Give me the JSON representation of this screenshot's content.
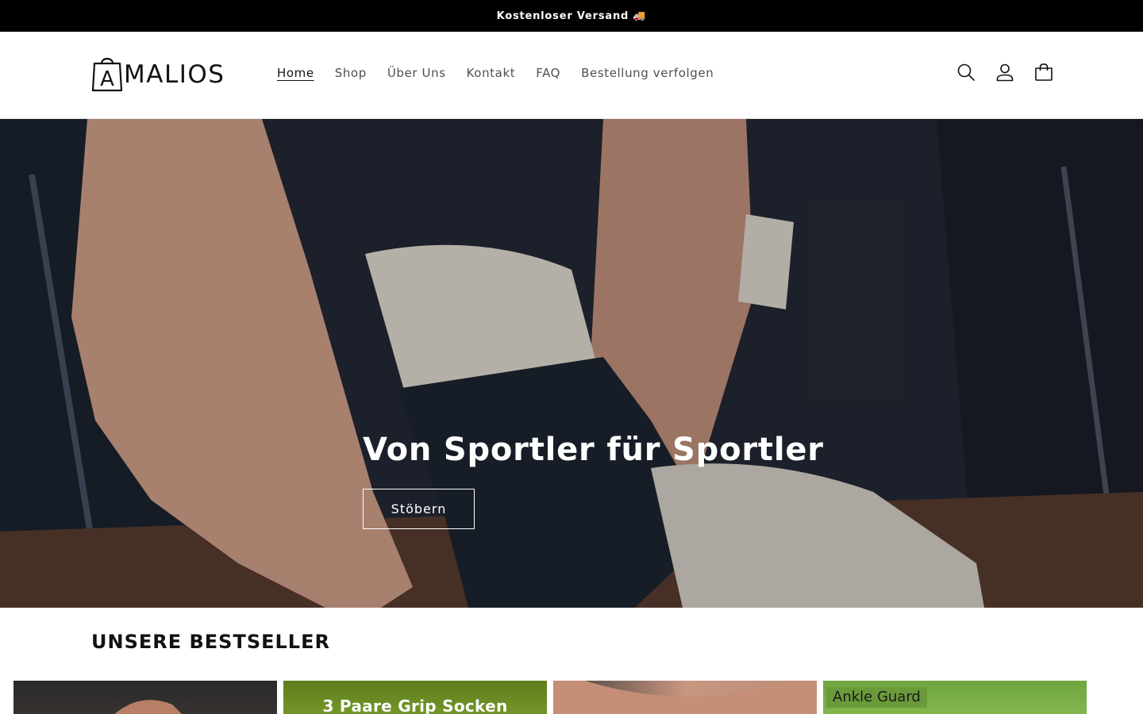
{
  "announcement": {
    "text": "Kostenloser Versand 🚚"
  },
  "header": {
    "logo_text": "MALIOS",
    "logo_letter": "A",
    "nav": [
      {
        "label": "Home",
        "active": true
      },
      {
        "label": "Shop",
        "active": false
      },
      {
        "label": "Über Uns",
        "active": false
      },
      {
        "label": "Kontakt",
        "active": false
      },
      {
        "label": "FAQ",
        "active": false
      },
      {
        "label": "Bestellung verfolgen",
        "active": false
      }
    ],
    "icons": [
      "search-icon",
      "account-icon",
      "cart-icon"
    ]
  },
  "hero": {
    "title": "Von Sportler für Sportler",
    "button_label": "Stöbern"
  },
  "bestsellers": {
    "title": "UNSERE BESTSELLER",
    "products": [
      {
        "caption": ""
      },
      {
        "caption": "3 Paare Grip Socken"
      },
      {
        "caption": ""
      },
      {
        "tag": "Ankle Guard"
      }
    ]
  },
  "colors": {
    "announcement_bg": "#000000",
    "text": "#121212",
    "hero_text": "#ffffff"
  }
}
